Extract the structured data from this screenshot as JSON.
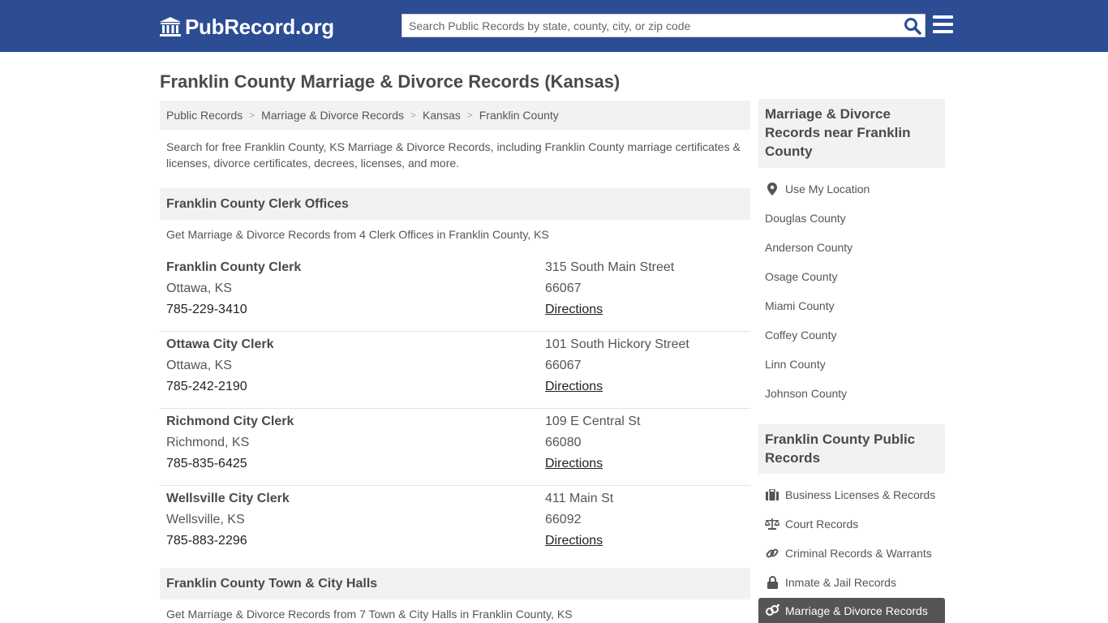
{
  "header": {
    "logo_text": "PubRecord.org",
    "search_placeholder": "Search Public Records by state, county, city, or zip code"
  },
  "page": {
    "title": "Franklin County Marriage & Divorce Records (Kansas)",
    "breadcrumb": [
      "Public Records",
      "Marriage & Divorce Records",
      "Kansas",
      "Franklin County"
    ],
    "intro": "Search for free Franklin County, KS Marriage & Divorce Records, including Franklin County marriage certificates & licenses, divorce certificates, decrees, licenses, and more."
  },
  "clerk_section": {
    "heading": "Franklin County Clerk Offices",
    "subtext": "Get Marriage & Divorce Records from 4 Clerk Offices in Franklin County, KS",
    "offices": [
      {
        "name": "Franklin County Clerk",
        "city": "Ottawa, KS",
        "phone": "785-229-3410",
        "address": "315 South Main Street",
        "zip": "66067",
        "directions": "Directions"
      },
      {
        "name": "Ottawa City Clerk",
        "city": "Ottawa, KS",
        "phone": "785-242-2190",
        "address": "101 South Hickory Street",
        "zip": "66067",
        "directions": "Directions"
      },
      {
        "name": "Richmond City Clerk",
        "city": "Richmond, KS",
        "phone": "785-835-6425",
        "address": "109 E Central St",
        "zip": "66080",
        "directions": "Directions"
      },
      {
        "name": "Wellsville City Clerk",
        "city": "Wellsville, KS",
        "phone": "785-883-2296",
        "address": "411 Main St",
        "zip": "66092",
        "directions": "Directions"
      }
    ]
  },
  "town_section": {
    "heading": "Franklin County Town & City Halls",
    "subtext": "Get Marriage & Divorce Records from 7 Town & City Halls in Franklin County, KS"
  },
  "sidebar": {
    "nearby_heading": "Marriage & Divorce Records near Franklin County",
    "use_location": "Use My Location",
    "nearby": [
      "Douglas County",
      "Anderson County",
      "Osage County",
      "Miami County",
      "Coffey County",
      "Linn County",
      "Johnson County"
    ],
    "public_heading": "Franklin County Public Records",
    "public_links": [
      {
        "label": "Business Licenses & Records",
        "icon": "briefcase-icon"
      },
      {
        "label": "Court Records",
        "icon": "scale-icon"
      },
      {
        "label": "Criminal Records & Warrants",
        "icon": "link-icon"
      },
      {
        "label": "Inmate & Jail Records",
        "icon": "lock-icon"
      },
      {
        "label": "Marriage & Divorce Records",
        "icon": "marriage-icon",
        "active": true
      }
    ]
  },
  "colors": {
    "header_bg": "#2c4c94",
    "panel_bg": "#f2f2f2",
    "active_bg": "#555555"
  }
}
